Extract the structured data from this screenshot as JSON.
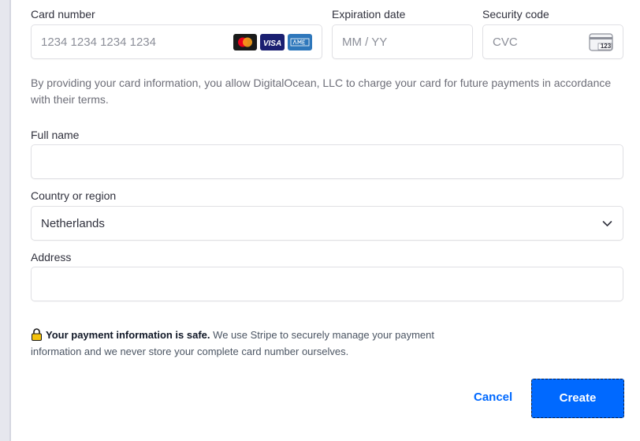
{
  "form": {
    "card_number_label": "Card number",
    "card_number_placeholder": "1234 1234 1234 1234",
    "card_brands": [
      "mastercard",
      "visa",
      "amex"
    ],
    "expiration_label": "Expiration date",
    "expiration_placeholder": "MM / YY",
    "security_label": "Security code",
    "security_placeholder": "CVC",
    "cvc_icon_text": "123",
    "consent_text": "By providing your card information, you allow DigitalOcean, LLC to charge your card for future payments in accordance with their terms.",
    "full_name_label": "Full name",
    "full_name_value": "",
    "country_label": "Country or region",
    "country_value": "Netherlands",
    "address_label": "Address",
    "address_value": ""
  },
  "notice": {
    "title": "Your payment information is safe.",
    "body": "We use Stripe to securely manage your payment information and we never store your complete card number ourselves."
  },
  "actions": {
    "cancel_label": "Cancel",
    "create_label": "Create"
  },
  "colors": {
    "accent": "#0069ff",
    "border": "#e0e0e4",
    "lock": "#f4c20d"
  }
}
